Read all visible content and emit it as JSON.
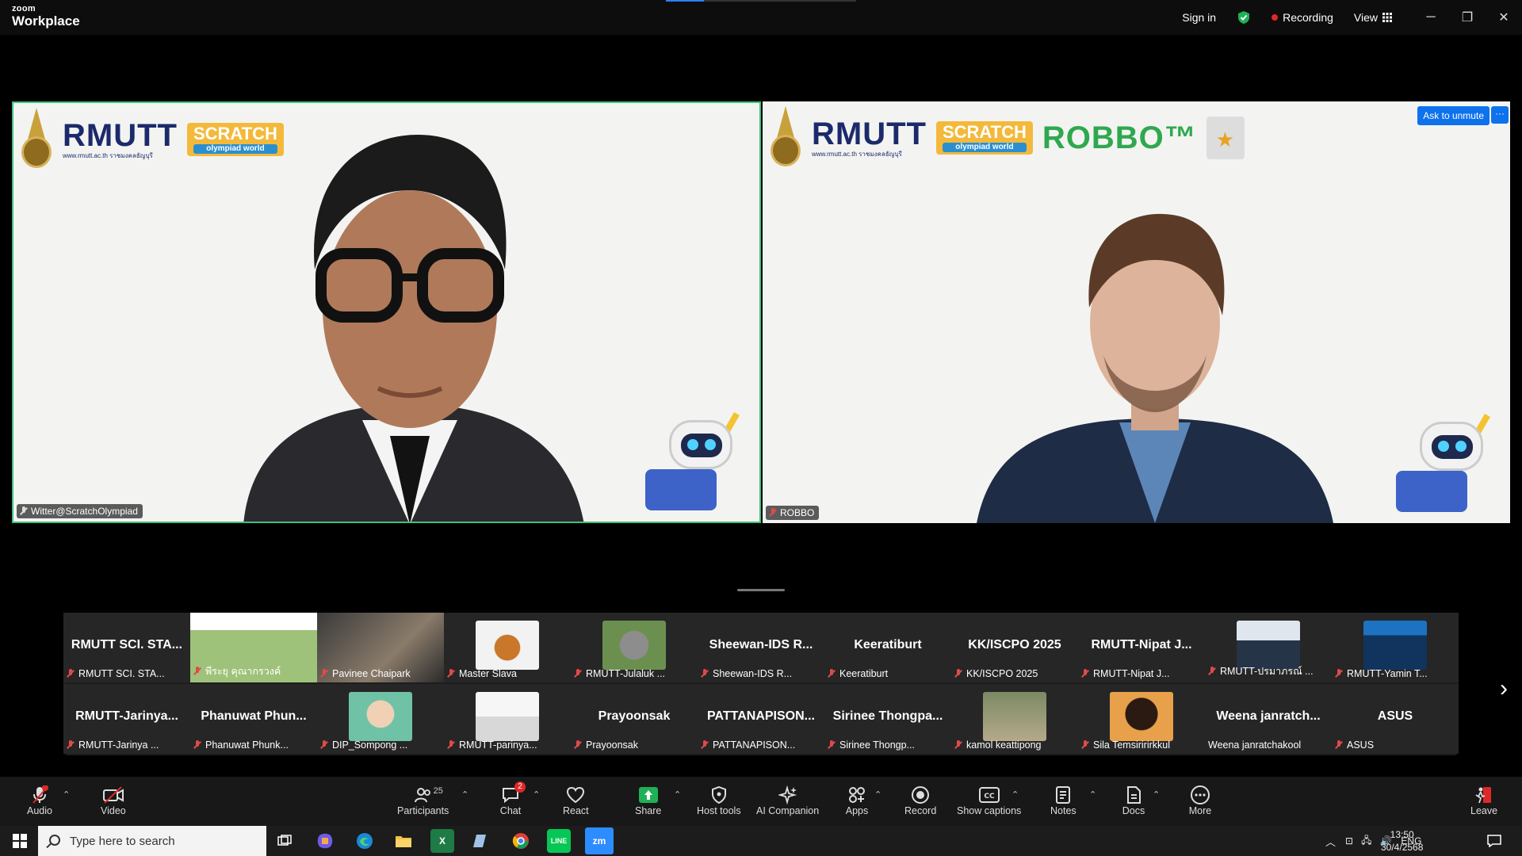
{
  "app": {
    "brand_top": "zoom",
    "brand_bottom": "Workplace"
  },
  "titlebar": {
    "sign_in": "Sign in",
    "recording": "Recording",
    "view": "View",
    "minimize": "─",
    "restore": "❐",
    "close": "✕"
  },
  "tiles": [
    {
      "name": "Witter@ScratchOlympiad",
      "logos": {
        "rmutt": "RMUTT",
        "rmutt_sub": "www.rmutt.ac.th  ราชมงคลธัญบุรี",
        "scratch": "SCRATCH",
        "scratch_sub": "olympiad world"
      }
    },
    {
      "name": "ROBBO",
      "logos": {
        "rmutt": "RMUTT",
        "rmutt_sub": "www.rmutt.ac.th  ราชมงคลธัญบุรี",
        "scratch": "SCRATCH",
        "scratch_sub": "olympiad world",
        "robbo": "ROBBO™"
      },
      "ask_unmute": "Ask to unmute",
      "more": "···"
    }
  ],
  "gallery": {
    "row1": [
      {
        "title": "RMUTT SCI. STA...",
        "label": "RMUTT SCI. STA..."
      },
      {
        "title": "",
        "label": "พีระยุ คุณากรวงค์"
      },
      {
        "title": "",
        "label": "Pavinee Chaipark"
      },
      {
        "title": "",
        "label": "Master Slava"
      },
      {
        "title": "",
        "label": "RMUTT-Julaluk ..."
      },
      {
        "title": "Sheewan-IDS R...",
        "label": "Sheewan-IDS R..."
      },
      {
        "title": "Keeratiburt",
        "label": "Keeratiburt"
      },
      {
        "title": "KK/ISCPO 2025",
        "label": "KK/ISCPO 2025"
      },
      {
        "title": "RMUTT-Nipat J...",
        "label": "RMUTT-Nipat J..."
      },
      {
        "title": "",
        "label": "RMUTT-ปรมาภรณ์ ..."
      },
      {
        "title": "",
        "label": "RMUTT-Yamin T..."
      }
    ],
    "row2": [
      {
        "title": "RMUTT-Jarinya...",
        "label": "RMUTT-Jarinya ..."
      },
      {
        "title": "Phanuwat  Phun...",
        "label": "Phanuwat Phunk..."
      },
      {
        "title": "",
        "label": "DIP_Sompong ..."
      },
      {
        "title": "",
        "label": "RMUTT-parinya..."
      },
      {
        "title": "Prayoonsak",
        "label": "Prayoonsak"
      },
      {
        "title": "PATTANAPISON...",
        "label": "PATTANAPISON..."
      },
      {
        "title": "Sirinee  Thongpa...",
        "label": "Sirinee Thongp..."
      },
      {
        "title": "",
        "label": "kamol keattipong"
      },
      {
        "title": "",
        "label": "Sila Temsiririrkkul"
      },
      {
        "title": "Weena  janratch...",
        "label": "Weena janratchakool"
      },
      {
        "title": "ASUS",
        "label": "ASUS"
      }
    ],
    "next": "›"
  },
  "toolbar": {
    "audio": "Audio",
    "video": "Video",
    "participants": "Participants",
    "participants_count": "25",
    "chat": "Chat",
    "chat_badge": "2",
    "react": "React",
    "share": "Share",
    "host_tools": "Host tools",
    "ai_companion": "AI Companion",
    "apps": "Apps",
    "record": "Record",
    "show_captions": "Show captions",
    "notes": "Notes",
    "docs": "Docs",
    "more": "More",
    "leave": "Leave"
  },
  "taskbar": {
    "search_placeholder": "Type here to search",
    "lang": "ENG",
    "time": "13:50",
    "date": "30/4/2568",
    "zoom_app": "zm"
  },
  "colors": {
    "accent": "#0e72ed",
    "active_speaker": "#3ac47d",
    "record_red": "#e02828"
  }
}
